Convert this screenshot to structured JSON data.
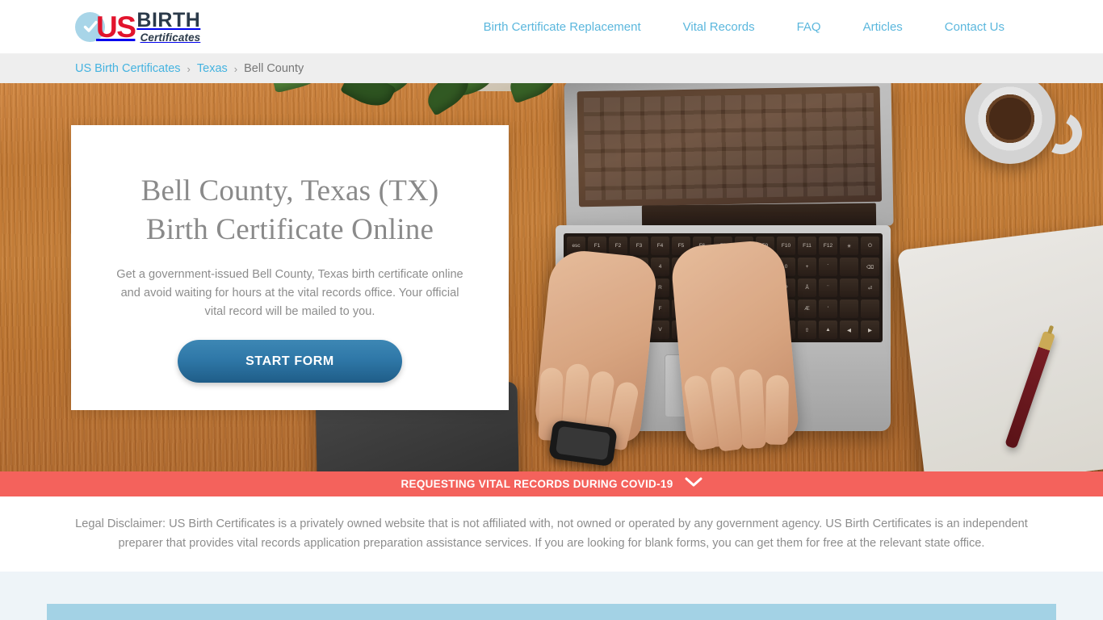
{
  "header": {
    "logo": {
      "check_icon": "check-circle-icon",
      "us": "US",
      "birth": "BIRTH",
      "certificates": "Certificates"
    },
    "nav": [
      {
        "label": "Birth Certificate Replacement"
      },
      {
        "label": "Vital Records"
      },
      {
        "label": "FAQ"
      },
      {
        "label": "Articles"
      },
      {
        "label": "Contact Us"
      }
    ]
  },
  "breadcrumb": {
    "home": "US Birth Certificates",
    "separator": "›",
    "state": "Texas",
    "current": "Bell County"
  },
  "hero": {
    "title_line1": "Bell County, Texas (TX)",
    "title_line2": "Birth Certificate Online",
    "subtitle": "Get a government-issued Bell County, Texas birth certificate online and avoid waiting for hours at the vital records office. Your official vital record will be mailed to you.",
    "cta_label": "START FORM",
    "background_description": "laptop-on-wooden-desk-with-hands-typing"
  },
  "covid_banner": {
    "text": "REQUESTING VITAL RECORDS DURING COVID-19",
    "chevron_icon": "chevron-down-icon",
    "color": "#f4625c"
  },
  "disclaimer": {
    "text": "Legal Disclaimer: US Birth Certificates is a privately owned website that is not affiliated with, not owned or operated by any government agency. US Birth Certificates is an independent preparer that provides vital records application preparation assistance services. If you are looking for blank forms, you can get them for free at the relevant state office."
  },
  "colors": {
    "nav_link": "#5bb7dd",
    "breadcrumb_link": "#45b3e0",
    "logo_red": "#e2142d",
    "logo_navy": "#2b3a4a",
    "cta_blue": "#2f78a8",
    "banner_red": "#f4625c",
    "bottom_bg": "#eef4f8",
    "blue_bar": "#a3d2e5"
  }
}
